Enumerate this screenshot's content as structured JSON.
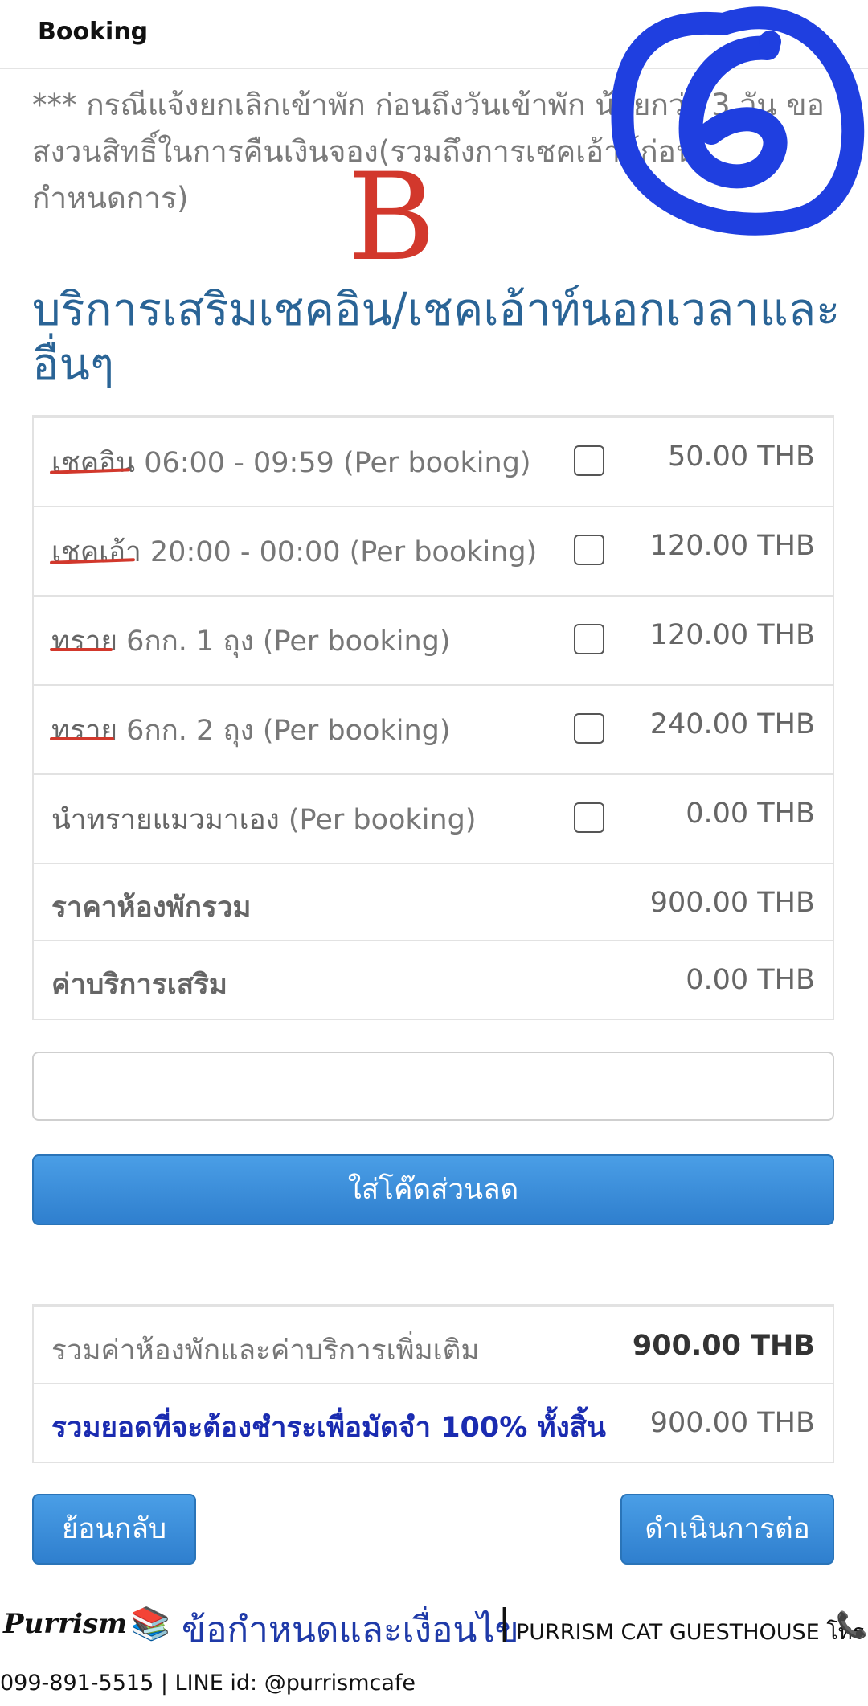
{
  "header": {
    "title": "Booking"
  },
  "notice": "*** กรณีแจ้งยกเลิกเข้าพัก ก่อนถึงวันเข้าพัก น้อยกว่า 3 วัน ขอสงวนสิทธิ์ในการคืนเงินจอง(รวมถึงการเชคเอ้าท์ก่อนกำหนดการ)",
  "section_title": "บริการเสริมเชคอิน/เชคเอ้าท์นอกเวลาและอื่นๆ",
  "options": [
    {
      "name": "เชคอิน",
      "detail": " 06:00 - 09:59 (Per booking)",
      "price": "50.00 THB",
      "checked": false
    },
    {
      "name": "เชคเอ้า",
      "detail": " 20:00 - 00:00 (Per booking)",
      "price": "120.00 THB",
      "checked": false
    },
    {
      "name": "ทราย",
      "detail": " 6กก. 1 ถุง (Per booking)",
      "price": "120.00 THB",
      "checked": false
    },
    {
      "name": "ทราย",
      "detail": " 6กก. 2 ถุง (Per booking)",
      "price": "240.00 THB",
      "checked": false
    },
    {
      "name": "นำทรายแมวมาเอง",
      "detail": " (Per booking)",
      "price": "0.00 THB",
      "checked": false
    }
  ],
  "summary": {
    "room_total_label": "ราคาห้องพักรวม",
    "room_total_value": "900.00 THB",
    "service_total_label": "ค่าบริการเสริม",
    "service_total_value": "0.00 THB"
  },
  "promo": {
    "input_value": "",
    "button_label": "ใส่โค๊ดส่วนลด"
  },
  "totals": {
    "combined_label": "รวมค่าห้องพักและค่าบริการเพิ่มเติม",
    "combined_value": "900.00 THB",
    "deposit_label": "รวมยอดที่จะต้องชำระเพื่อมัดจำ 100% ทั้งสิ้น",
    "deposit_value": "900.00 THB"
  },
  "actions": {
    "back_label": "ย้อนกลับ",
    "next_label": "ดำเนินการต่อ"
  },
  "footer": {
    "brand": "Purrism",
    "books_icon": "books-icon",
    "terms_link": "ข้อกำหนดและเงื่อนไข",
    "separator": "|",
    "guesthouse": "PURRISM CAT GUESTHOUSE โทร",
    "phone_icon": "phone-icon",
    "contact": "099-891-5515 | LINE id: @purrismcafe"
  },
  "annotations": {
    "letter": "B",
    "number": "6"
  },
  "colors": {
    "primary_button": "#2f7fce",
    "title_blue": "#2a6496",
    "deposit_blue": "#1a2bb0",
    "annotation_red": "#d2382c",
    "annotation_blue": "#1f3fe0"
  }
}
